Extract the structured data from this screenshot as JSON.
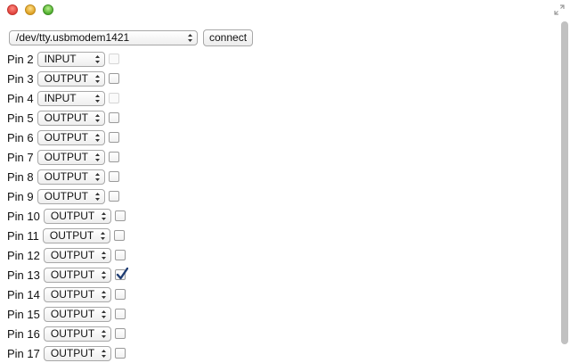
{
  "window": {
    "controls": [
      "close",
      "minimize",
      "zoom"
    ],
    "fullscreen_icon": "fullscreen-arrows-icon"
  },
  "serial": {
    "port_value": "/dev/tty.usbmodem1421",
    "connect_label": "connect"
  },
  "pins": [
    {
      "label": "Pin 2",
      "mode": "INPUT",
      "checked": false,
      "enabled": false
    },
    {
      "label": "Pin 3",
      "mode": "OUTPUT",
      "checked": false,
      "enabled": true
    },
    {
      "label": "Pin 4",
      "mode": "INPUT",
      "checked": false,
      "enabled": false
    },
    {
      "label": "Pin 5",
      "mode": "OUTPUT",
      "checked": false,
      "enabled": true
    },
    {
      "label": "Pin 6",
      "mode": "OUTPUT",
      "checked": false,
      "enabled": true
    },
    {
      "label": "Pin 7",
      "mode": "OUTPUT",
      "checked": false,
      "enabled": true
    },
    {
      "label": "Pin 8",
      "mode": "OUTPUT",
      "checked": false,
      "enabled": true
    },
    {
      "label": "Pin 9",
      "mode": "OUTPUT",
      "checked": false,
      "enabled": true
    },
    {
      "label": "Pin 10",
      "mode": "OUTPUT",
      "checked": false,
      "enabled": true
    },
    {
      "label": "Pin 11",
      "mode": "OUTPUT",
      "checked": false,
      "enabled": true
    },
    {
      "label": "Pin 12",
      "mode": "OUTPUT",
      "checked": false,
      "enabled": true
    },
    {
      "label": "Pin 13",
      "mode": "OUTPUT",
      "checked": true,
      "enabled": true
    },
    {
      "label": "Pin 14",
      "mode": "OUTPUT",
      "checked": false,
      "enabled": true
    },
    {
      "label": "Pin 15",
      "mode": "OUTPUT",
      "checked": false,
      "enabled": true
    },
    {
      "label": "Pin 16",
      "mode": "OUTPUT",
      "checked": false,
      "enabled": true
    },
    {
      "label": "Pin 17",
      "mode": "OUTPUT",
      "checked": false,
      "enabled": true
    }
  ],
  "colors": {
    "close": "#e0443e",
    "minimize": "#dea123",
    "zoom": "#4fae2f",
    "check": "#1f3d73"
  }
}
